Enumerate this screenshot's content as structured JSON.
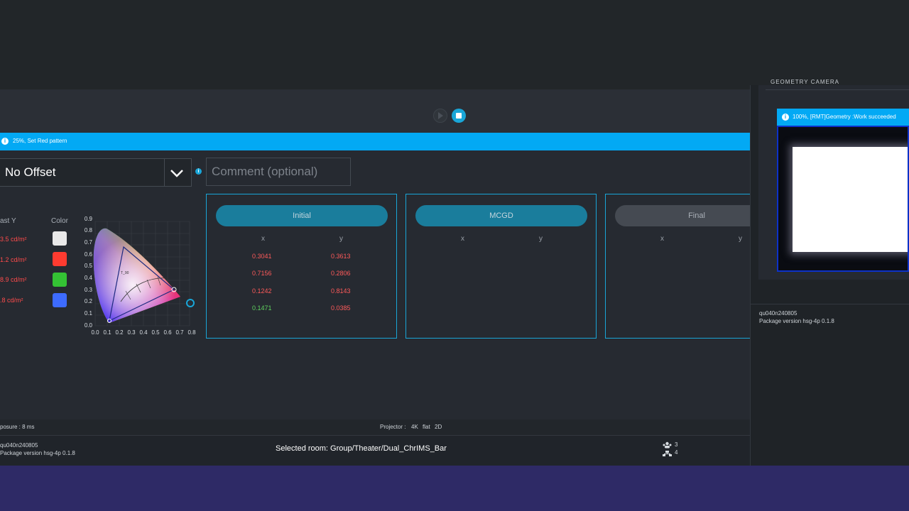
{
  "progress": {
    "text": "25%, Set Red pattern"
  },
  "offset": {
    "selected": "No Offset"
  },
  "comment": {
    "placeholder": "Comment (optional)"
  },
  "luminance": {
    "header_y": "ast Y",
    "header_color": "Color",
    "rows": [
      {
        "value": "3.5 cd/m²",
        "color": "#e9e9e9"
      },
      {
        "value": "1.2 cd/m²",
        "color": "#ff3b30"
      },
      {
        "value": "8.9 cd/m²",
        "color": "#34c234"
      },
      {
        "value": ".8 cd/m²",
        "color": "#3d6bff"
      }
    ]
  },
  "cie_chart": {
    "y_ticks": [
      "0.9",
      "0.8",
      "0.7",
      "0.6",
      "0.5",
      "0.4",
      "0.3",
      "0.2",
      "0.1",
      "0.0"
    ],
    "x_ticks": [
      "0.0",
      "0.1",
      "0.2",
      "0.3",
      "0.4",
      "0.5",
      "0.6",
      "0.7",
      "0.8"
    ]
  },
  "panels": [
    {
      "title": "Initial",
      "col_x": "x",
      "col_y": "y",
      "rows": [
        {
          "x": "0.3041",
          "y": "0.3613",
          "x_color": "red",
          "y_color": "red"
        },
        {
          "x": "0.7156",
          "y": "0.2806",
          "x_color": "red",
          "y_color": "red"
        },
        {
          "x": "0.1242",
          "y": "0.8143",
          "x_color": "red",
          "y_color": "red"
        },
        {
          "x": "0.1471",
          "y": "0.0385",
          "x_color": "green",
          "y_color": "red"
        }
      ]
    },
    {
      "title": "MCGD",
      "col_x": "x",
      "col_y": "y",
      "rows": []
    },
    {
      "title": "Final",
      "col_x": "x",
      "col_y": "y",
      "rows": []
    }
  ],
  "status": {
    "exposure": "posure : 8 ms",
    "projector_label": "Projector :",
    "projector_res": "4K",
    "projector_format": "flat",
    "projector_mode": "2D"
  },
  "footer": {
    "device_id": "qu040n240805",
    "package_version": "Package version hsg-4p 0.1.8",
    "selected_room": "Selected room: Group/Theater/Dual_ChrIMS_Bar",
    "count_top": "3",
    "count_bottom": "4"
  },
  "right_panel": {
    "title": "GEOMETRY CAMERA",
    "notification": "100%, [RMT]Geometry :Work succeeded",
    "device_id": "qu040n240805",
    "package_version": "Package version hsg-4p 0.1.8"
  },
  "colors": {
    "accent": "#03a9f4",
    "panel_border": "#19a6d8",
    "bottom_band": "#2e2a66"
  }
}
